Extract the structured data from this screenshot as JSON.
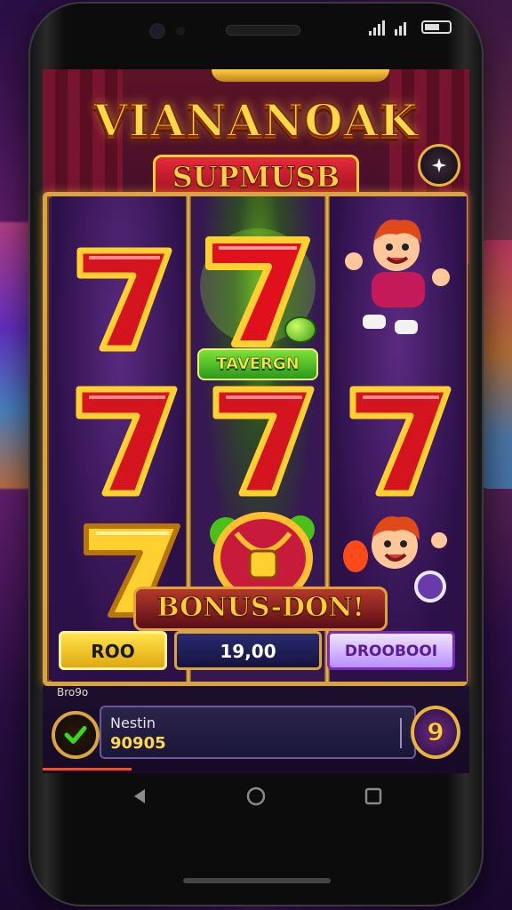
{
  "game": {
    "title": "VIANANOAK",
    "subtitle": "SUPMUSB",
    "wild_badge": "TAVERGN",
    "bonus_banner": "BONUS-DON!"
  },
  "controls": {
    "bet_label": "ROO",
    "win_value": "19,00",
    "spin_label": "DROOBOOI"
  },
  "player": {
    "small_label": "Bro9o",
    "name": "Nestin",
    "score": "90905",
    "level": "9"
  },
  "icons": {
    "add": "plus-sparkle-icon",
    "confirm": "check-icon",
    "nav": [
      "back-icon",
      "home-icon",
      "recent-apps-icon"
    ]
  },
  "colors": {
    "gold": "#d9a53c",
    "seven_red": "#d4141f",
    "seven_gold": "#ffd030",
    "accent_purple": "#7a2ab8"
  },
  "reels": [
    [
      "red-seven",
      "red-seven",
      "gold-seven"
    ],
    [
      "glowing-red-seven",
      "red-seven",
      "treasure-chest"
    ],
    [
      "cheering-kid",
      "red-seven",
      "cheering-kid"
    ]
  ]
}
